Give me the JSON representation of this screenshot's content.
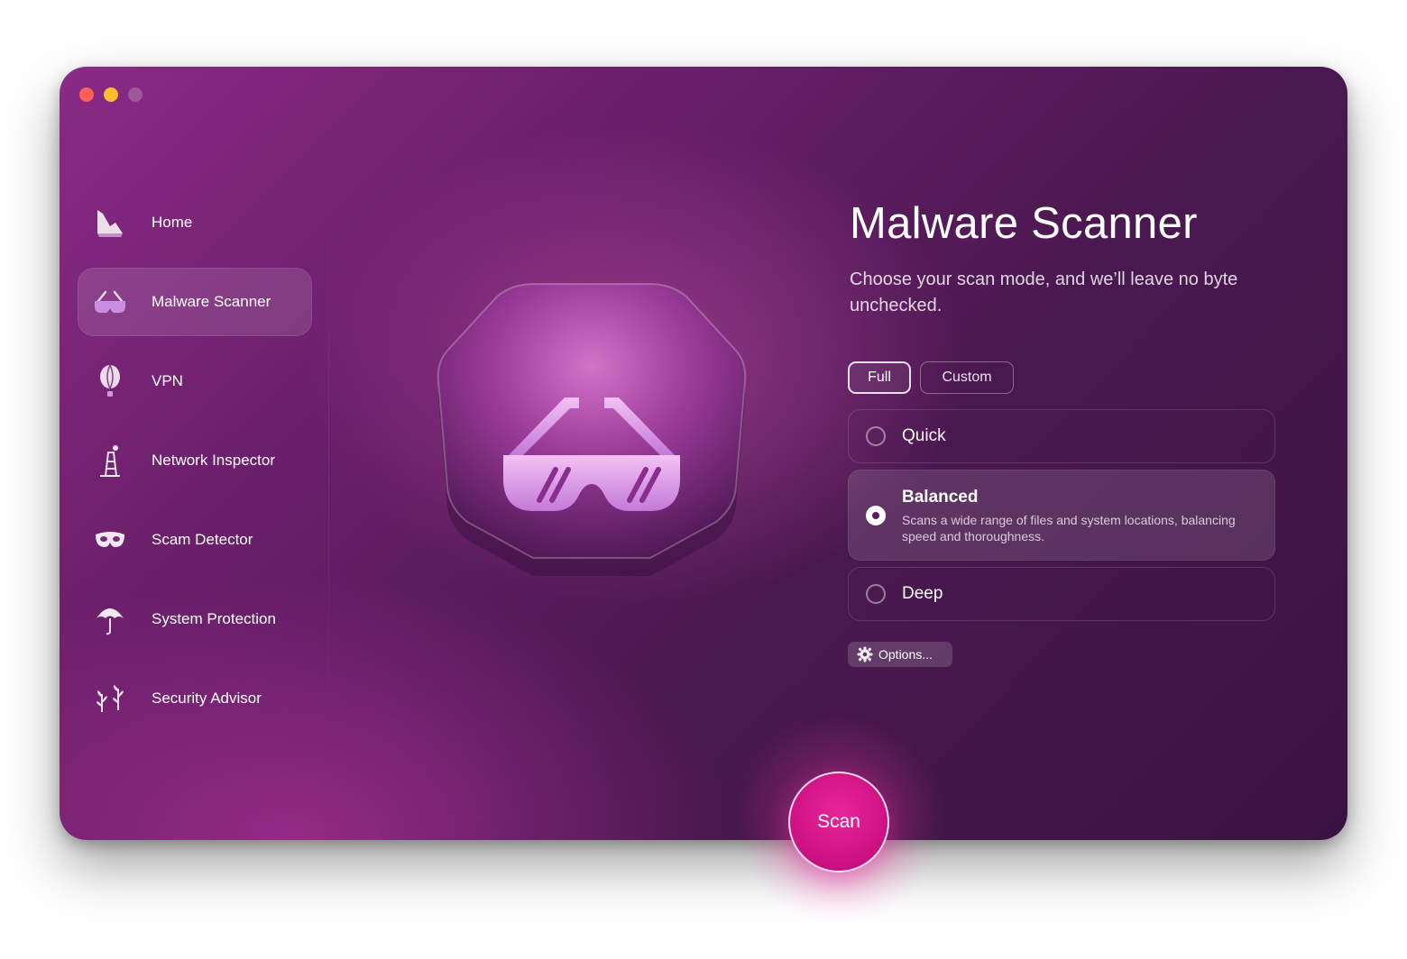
{
  "window": {
    "controls": [
      "close",
      "minimize",
      "zoom"
    ]
  },
  "sidebar": {
    "items": [
      {
        "label": "Home",
        "icon": "home-icon",
        "active": false
      },
      {
        "label": "Malware Scanner",
        "icon": "glasses-icon",
        "active": true
      },
      {
        "label": "VPN",
        "icon": "balloon-icon",
        "active": false
      },
      {
        "label": "Network Inspector",
        "icon": "tower-icon",
        "active": false
      },
      {
        "label": "Scam Detector",
        "icon": "mask-icon",
        "active": false
      },
      {
        "label": "System Protection",
        "icon": "umbrella-icon",
        "active": false
      },
      {
        "label": "Security Advisor",
        "icon": "plant-icon",
        "active": false
      }
    ]
  },
  "main": {
    "title": "Malware Scanner",
    "subtitle": "Choose your scan mode, and we’ll leave no byte unchecked.",
    "hero_icon": "sunglasses-icon",
    "mode_tabs": {
      "full": "Full",
      "custom": "Custom",
      "selected": "Full"
    },
    "scan_options": [
      {
        "label": "Quick",
        "selected": false
      },
      {
        "label": "Balanced",
        "selected": true,
        "description": "Scans a wide range of files and system locations, balancing speed and thoroughness."
      },
      {
        "label": "Deep",
        "selected": false
      }
    ],
    "options_button": "Options...",
    "scan_button": "Scan"
  },
  "colors": {
    "accent": "#d41a8c",
    "background_dark": "#3a1440",
    "background_light": "#8a2a86"
  }
}
